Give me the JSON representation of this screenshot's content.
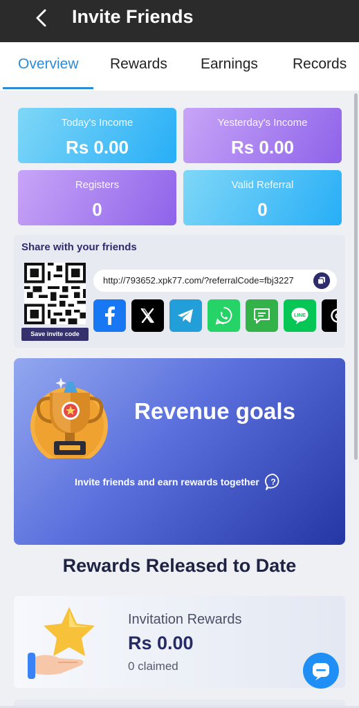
{
  "header": {
    "title": "Invite Friends",
    "back_icon": "chevron-left-icon"
  },
  "tabs": [
    {
      "label": "Overview",
      "active": true
    },
    {
      "label": "Rewards",
      "active": false
    },
    {
      "label": "Earnings",
      "active": false
    },
    {
      "label": "Records",
      "active": false
    }
  ],
  "stats": [
    {
      "label": "Today's Income",
      "value": "Rs 0.00"
    },
    {
      "label": "Yesterday's Income",
      "value": "Rs 0.00"
    },
    {
      "label": "Registers",
      "value": "0"
    },
    {
      "label": "Valid Referral",
      "value": "0"
    }
  ],
  "share": {
    "title": "Share with your friends",
    "save_label": "Save invite code",
    "link": "http://793652.xpk77.com/?referralCode=fbj3227",
    "social": [
      {
        "icon": "facebook-icon",
        "color": "#1877f2"
      },
      {
        "icon": "x-icon",
        "color": "#000000"
      },
      {
        "icon": "telegram-icon",
        "color": "#229ed9"
      },
      {
        "icon": "whatsapp-icon",
        "color": "#25d366"
      },
      {
        "icon": "sms-icon",
        "color": "#34b24a"
      },
      {
        "icon": "line-icon",
        "color": "#06c755"
      },
      {
        "icon": "threads-icon",
        "color": "#000000"
      }
    ]
  },
  "revenue": {
    "title": "Revenue goals",
    "subtitle": "Invite friends and earn rewards together"
  },
  "rewards_section": {
    "title": "Rewards Released to Date"
  },
  "invitation_rewards": {
    "label": "Invitation Rewards",
    "value": "Rs 0.00",
    "claimed": "0 claimed"
  },
  "colors": {
    "header_bg": "#2b2b2b",
    "accent": "#2d8ad6",
    "navy": "#2e2c6c",
    "chat_button": "#1f8ff5"
  }
}
